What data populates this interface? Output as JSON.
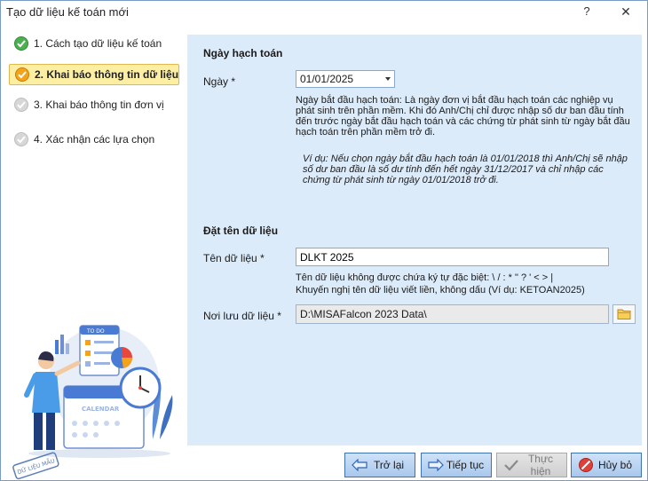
{
  "window": {
    "title": "Tạo dữ liệu kế toán mới",
    "help_label": "?",
    "close_label": "✕"
  },
  "steps": [
    {
      "label": "1. Cách tạo dữ liệu kế toán",
      "state": "done"
    },
    {
      "label": "2. Khai báo thông tin dữ liệu",
      "state": "active"
    },
    {
      "label": "3. Khai báo thông tin đơn vị",
      "state": "pending"
    },
    {
      "label": "4. Xác nhận các lựa chọn",
      "state": "pending"
    }
  ],
  "illustration": {
    "todo_text": "TO DO",
    "calendar_text": "CALENDAR",
    "stamp_text": "DỮ LIỆU MẪU"
  },
  "accounting_date": {
    "section_title": "Ngày hạch toán",
    "field_label": "Ngày *",
    "value": "01/01/2025",
    "description": "Ngày bắt đầu hạch toán: Là ngày đơn vị bắt đầu hạch toán các nghiệp vụ phát sinh trên phần mềm. Khi đó Anh/Chị chỉ được nhập số dư ban đầu tính đến trước ngày bắt đầu hạch toán và các chứng từ phát sinh từ ngày bắt đầu hạch toán trên phần mềm trở đi.",
    "example": "Ví dụ: Nếu chọn ngày bắt đầu hạch toán là 01/01/2018 thì Anh/Chị sẽ nhập số dư ban đầu là số dư tính đến hết ngày 31/12/2017 và chỉ nhập các chứng từ phát sinh từ ngày 01/01/2018 trở đi."
  },
  "data_name": {
    "section_title": "Đặt tên dữ liệu",
    "name_label": "Tên dữ liệu *",
    "name_value": "DLKT 2025",
    "hint_line1": "Tên dữ liệu không được chứa ký tự đặc biệt: \\ / : * \" ? ' < > |",
    "hint_line2": "Khuyến nghị tên dữ liệu viết liền, không dấu (Ví dụ: KETOAN2025)",
    "location_label": "Nơi lưu dữ liệu *",
    "location_value": "D:\\MISAFalcon 2023 Data\\"
  },
  "buttons": {
    "back": "Trở lại",
    "next": "Tiếp tục",
    "execute": "Thực hiện",
    "cancel": "Hủy bỏ"
  },
  "colors": {
    "content_bg": "#dcebfa",
    "active_step_bg": "#fcefa3",
    "button_border": "#3f73b0"
  }
}
